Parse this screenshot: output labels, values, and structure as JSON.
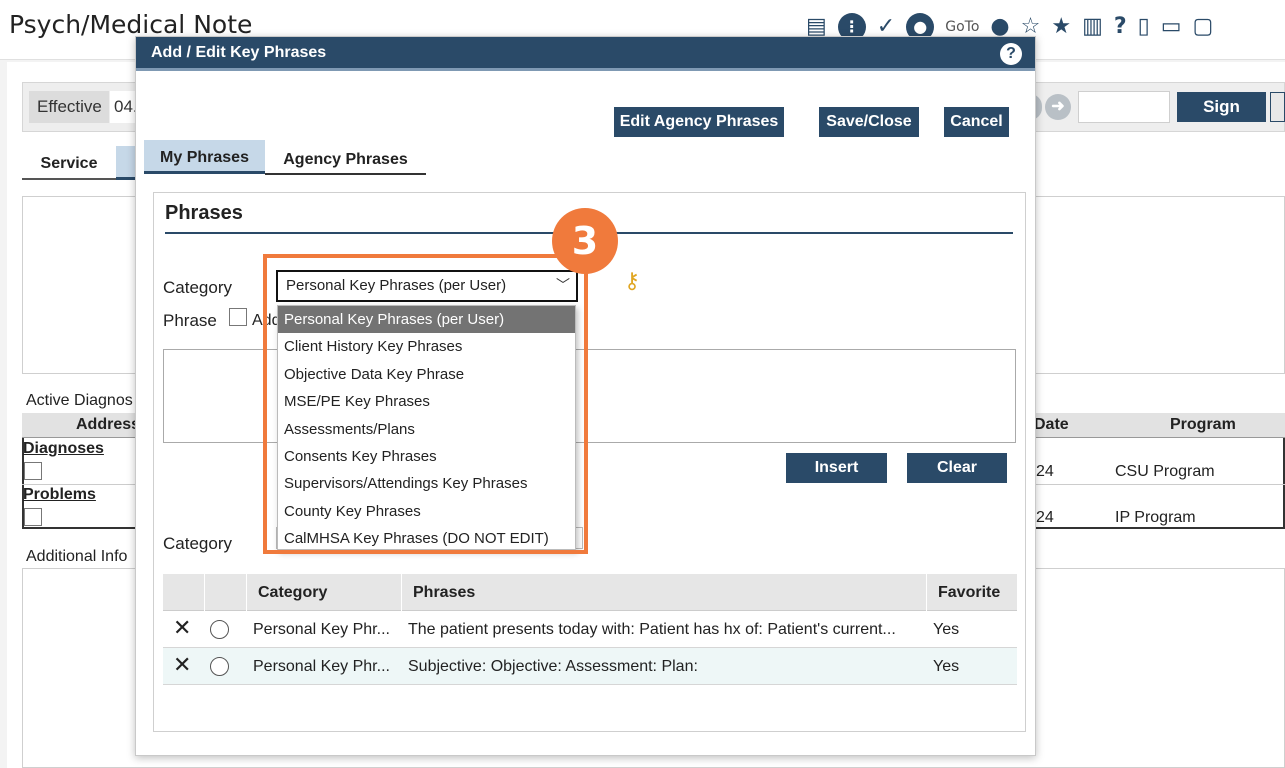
{
  "page": {
    "title": "Psych/Medical Note",
    "goto_label": "GoTo",
    "effective_label": "Effective",
    "effective_value": "04.",
    "sign_label": "Sign",
    "service_tab": "Service"
  },
  "background": {
    "active_diagnoses": "Active Diagnos",
    "table_headers": {
      "address": "Address",
      "date": "Date",
      "program": "Program"
    },
    "diagnoses_link": "Diagnoses",
    "problems_link": "Problems",
    "row1": {
      "date": "24",
      "program": "CSU Program"
    },
    "row2": {
      "date": "24",
      "program": "IP Program"
    },
    "additional_info": "Additional Info"
  },
  "modal": {
    "title": "Add / Edit Key Phrases",
    "help": "?",
    "buttons": {
      "edit_agency": "Edit Agency Phrases",
      "save_close": "Save/Close",
      "cancel": "Cancel",
      "insert": "Insert",
      "clear": "Clear"
    },
    "tabs": {
      "my_phrases": "My Phrases",
      "agency_phrases": "Agency Phrases"
    },
    "section_title": "Phrases",
    "category_label": "Category",
    "phrase_label": "Phrase",
    "phrase_checkbox_label": "Add",
    "category_selected": "Personal Key Phrases (per User)",
    "lower_category_label": "Category"
  },
  "dropdown": {
    "options": [
      "Personal Key Phrases (per User)",
      "Client History Key Phrases",
      "Objective Data Key Phrase",
      "MSE/PE Key Phrases",
      "Assessments/Plans",
      "Consents Key Phrases",
      "Supervisors/Attendings Key Phrases",
      "County Key Phrases",
      "CalMHSA Key Phrases (DO NOT EDIT)"
    ]
  },
  "annotation": {
    "step": "3",
    "color": "#f07a3c"
  },
  "grid": {
    "headers": {
      "category": "Category",
      "phrases": "Phrases",
      "favorite": "Favorite"
    },
    "rows": [
      {
        "category": "Personal Key Phr...",
        "phrases": "The patient presents today with: Patient has hx of: Patient's current...",
        "favorite": "Yes"
      },
      {
        "category": "Personal Key Phr...",
        "phrases": "Subjective: Objective: Assessment: Plan:",
        "favorite": "Yes"
      }
    ]
  },
  "colors": {
    "header": "#2a4a68",
    "tab_active": "#c6d8e8",
    "selected_option": "#737373"
  }
}
